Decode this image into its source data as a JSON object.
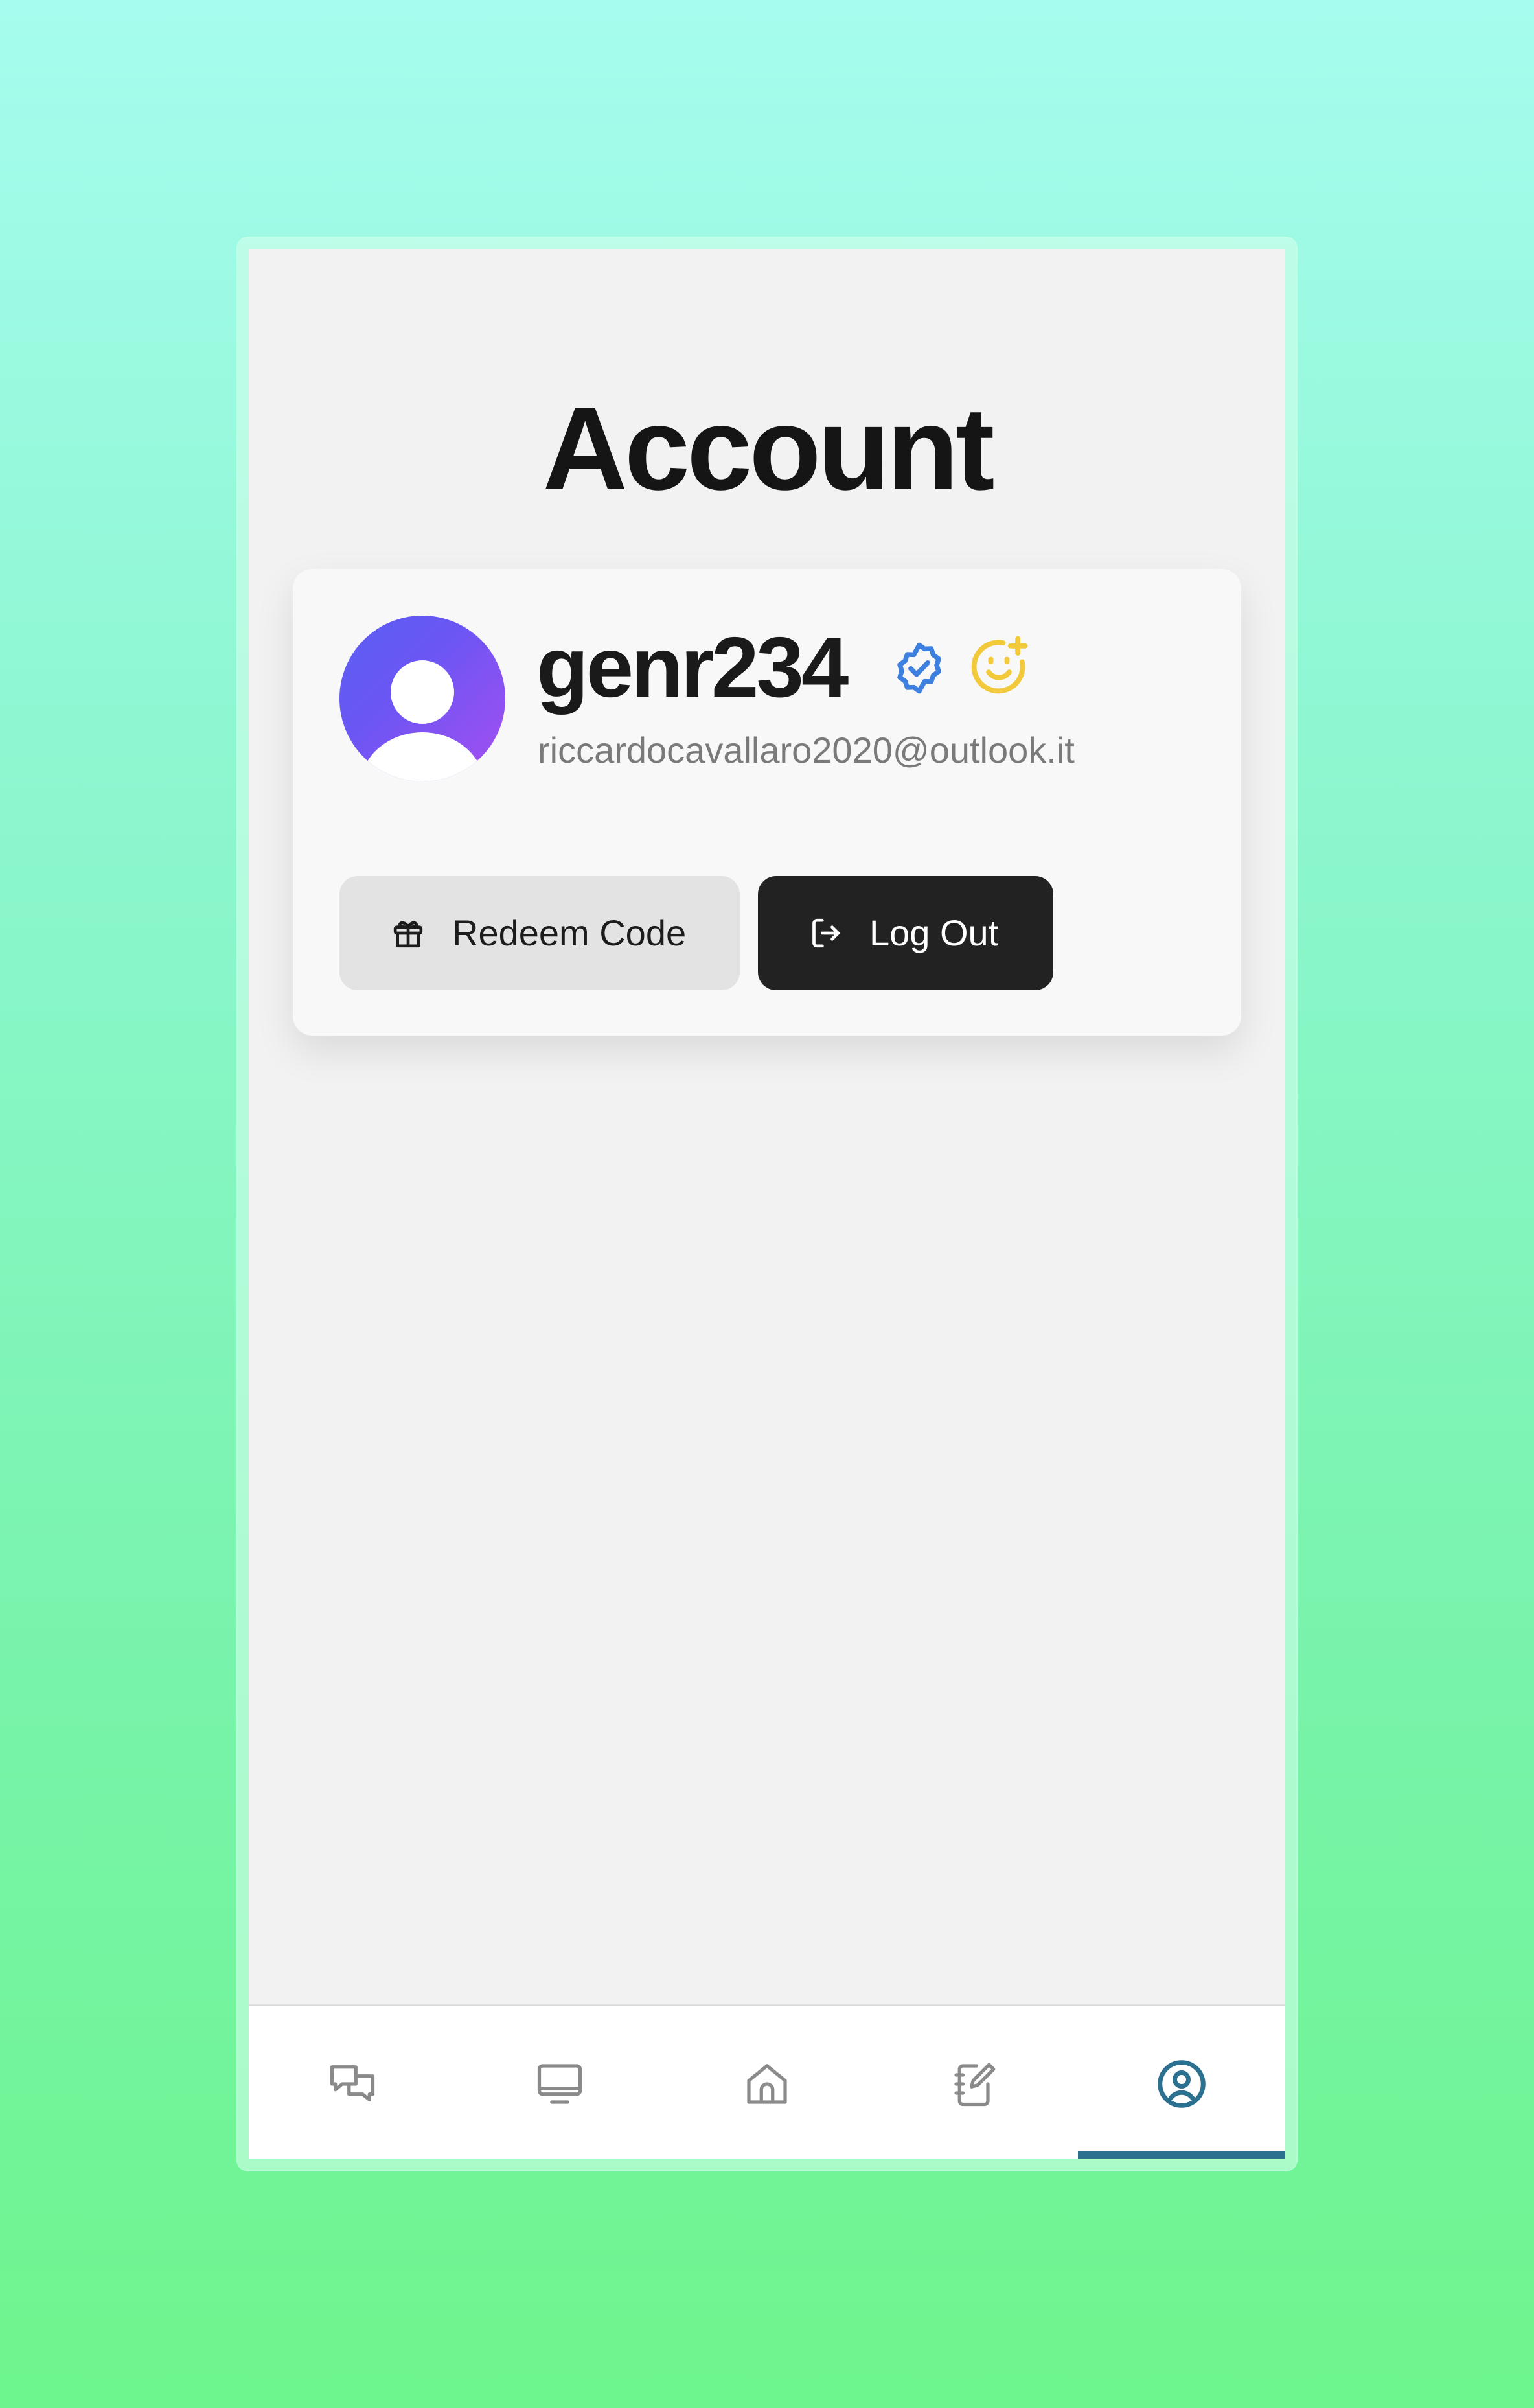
{
  "page": {
    "title": "Account"
  },
  "profile": {
    "username": "genr234",
    "email": "riccardocavallaro2020@outlook.it",
    "avatar_icon": "user-avatar-icon",
    "verified_icon": "verified-badge-icon",
    "mood_icon": "smiley-add-icon"
  },
  "actions": {
    "redeem_label": "Redeem Code",
    "redeem_icon": "gift-icon",
    "logout_label": "Log Out",
    "logout_icon": "logout-icon"
  },
  "nav": {
    "items": [
      {
        "icon": "chat-icon",
        "active": false
      },
      {
        "icon": "monitor-icon",
        "active": false
      },
      {
        "icon": "home-icon",
        "active": false
      },
      {
        "icon": "notebook-edit-icon",
        "active": false
      },
      {
        "icon": "account-icon",
        "active": true
      }
    ]
  },
  "colors": {
    "accent": "#2c7090",
    "verified": "#3d80e0",
    "mood": "#f2c93a",
    "logout_bg": "#222222",
    "redeem_bg": "#e4e3e4"
  }
}
